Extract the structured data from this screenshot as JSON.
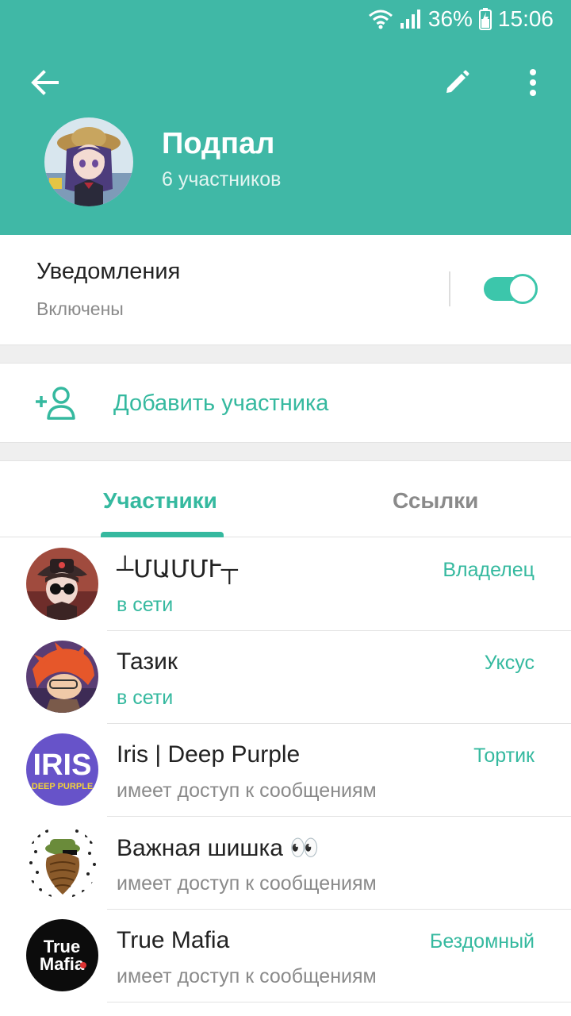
{
  "statusbar": {
    "battery": "36%",
    "time": "15:06"
  },
  "header": {
    "title": "Подпал",
    "subtitle": "6 участников"
  },
  "notifications": {
    "title": "Уведомления",
    "state": "Включены",
    "enabled": true
  },
  "add_member": {
    "label": "Добавить участника"
  },
  "tabs": [
    {
      "label": "Участники",
      "active": true
    },
    {
      "label": "Ссылки",
      "active": false
    }
  ],
  "members": [
    {
      "name": "┴ՄԱՄՄՒ┬",
      "status": "в сети",
      "role": "Владелец",
      "status_type": "online"
    },
    {
      "name": "Тазик",
      "status": "в сети",
      "role": "Уксус",
      "status_type": "online"
    },
    {
      "name": "Iris | Deep Purple",
      "status": "имеет доступ к сообщениям",
      "role": "Тортик",
      "status_type": "access",
      "avatar_text_top": "IRIS",
      "avatar_text_bottom": "DEEP PURPLE"
    },
    {
      "name": "Важная шишка 👀",
      "status": "имеет доступ к сообщениям",
      "role": "",
      "status_type": "access"
    },
    {
      "name": "True Mafia",
      "status": "имеет доступ к сообщениям",
      "role": "Бездомный",
      "status_type": "access",
      "avatar_text_top": "True",
      "avatar_text_bottom": "Mafia"
    }
  ],
  "colors": {
    "header": "#40b8a6",
    "accent": "#35b99f",
    "secondary_text": "#8a8a8a"
  }
}
